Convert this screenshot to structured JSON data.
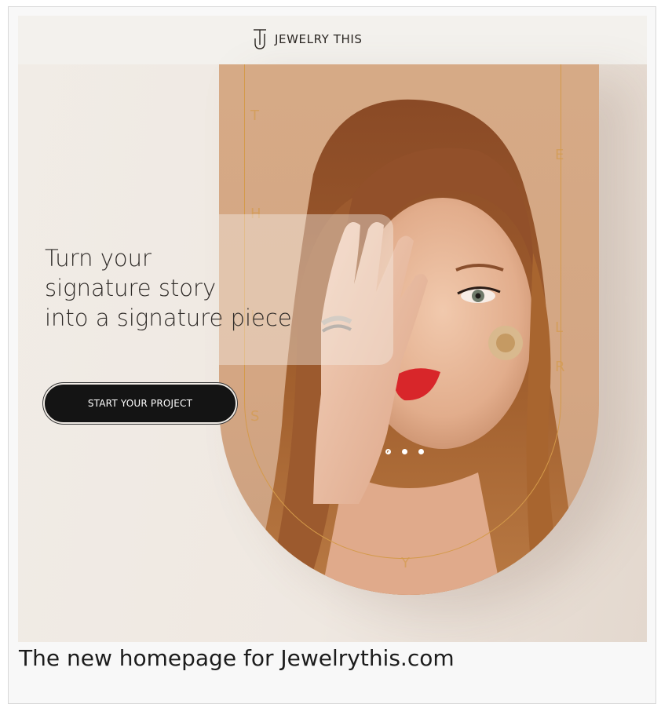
{
  "brand": {
    "name": "JEWELRY THIS",
    "logo_icon": "jt-monogram-icon"
  },
  "hero": {
    "headline_lines": [
      "Turn your",
      "signature story",
      "into a signature piece"
    ],
    "cta_label": "START YOUR PROJECT",
    "arch_letters": [
      "T",
      "H",
      "I",
      "S",
      "E",
      "L",
      "R",
      "Y"
    ],
    "carousel": {
      "slide_count": 3,
      "active_index": 0
    }
  },
  "caption": "The new homepage for Jewelrythis.com",
  "colors": {
    "accent_gold": "#d49a4a",
    "button_bg": "#141414",
    "page_bg": "#f1ece6",
    "arch_bg": "#d6aa86"
  }
}
